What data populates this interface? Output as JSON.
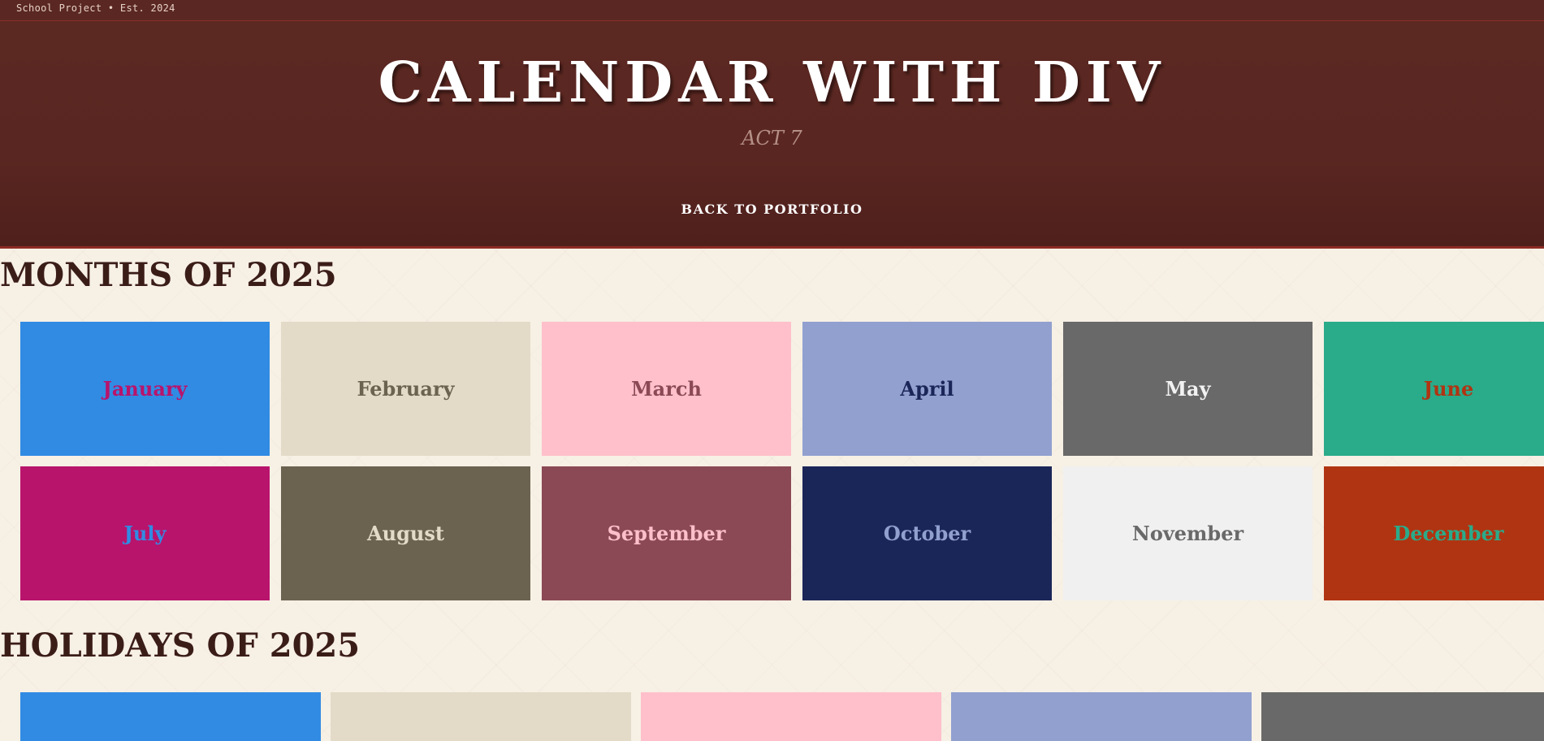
{
  "topbar": {
    "text": "School Project • Est. 2024"
  },
  "header": {
    "title": "CALENDAR WITH DIV",
    "subtitle": "ACT 7",
    "nav_link": "BACK TO PORTFOLIO"
  },
  "months_section": {
    "heading": "MONTHS OF 2025",
    "months": [
      {
        "label": "January",
        "bg": "#318be3",
        "fg": "#b8146c"
      },
      {
        "label": "February",
        "bg": "#e3dbc8",
        "fg": "#6b6350"
      },
      {
        "label": "March",
        "bg": "#ffc0cb",
        "fg": "#8b4956"
      },
      {
        "label": "April",
        "bg": "#91a0cf",
        "fg": "#1b2658"
      },
      {
        "label": "May",
        "bg": "#696969",
        "fg": "#f2f2f2"
      },
      {
        "label": "June",
        "bg": "#2aab8a",
        "fg": "#b03412"
      },
      {
        "label": "July",
        "bg": "#b8146c",
        "fg": "#318be3"
      },
      {
        "label": "August",
        "bg": "#6b6350",
        "fg": "#e3dbc8"
      },
      {
        "label": "September",
        "bg": "#8b4956",
        "fg": "#ffc0cb"
      },
      {
        "label": "October",
        "bg": "#1b2658",
        "fg": "#91a0cf"
      },
      {
        "label": "November",
        "bg": "#f0f0f0",
        "fg": "#696969"
      },
      {
        "label": "December",
        "bg": "#b03412",
        "fg": "#2aab8a"
      }
    ]
  },
  "holidays_section": {
    "heading": "HOLIDAYS OF 2025",
    "cards": [
      {
        "bg": "#318be3"
      },
      {
        "bg": "#e3dbc8"
      },
      {
        "bg": "#ffc0cb"
      },
      {
        "bg": "#91a0cf"
      },
      {
        "bg": "#696969"
      }
    ]
  }
}
